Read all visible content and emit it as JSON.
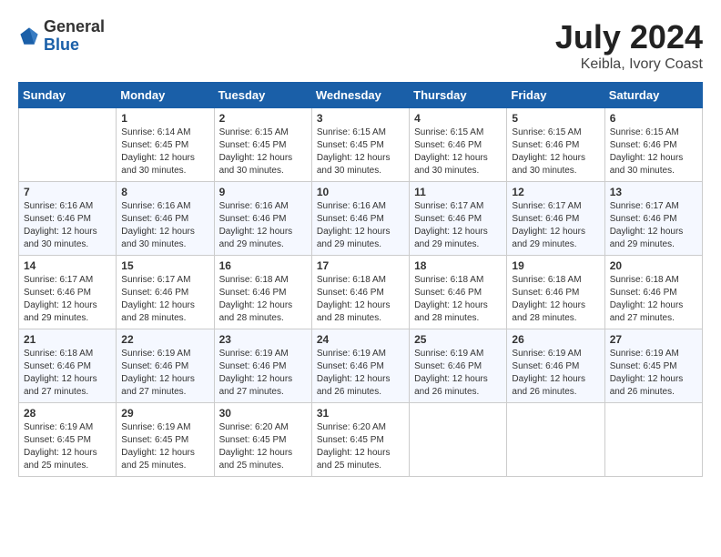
{
  "header": {
    "logo_general": "General",
    "logo_blue": "Blue",
    "title": "July 2024",
    "subtitle": "Keibla, Ivory Coast"
  },
  "columns": [
    "Sunday",
    "Monday",
    "Tuesday",
    "Wednesday",
    "Thursday",
    "Friday",
    "Saturday"
  ],
  "weeks": [
    [
      {
        "day": "",
        "info": ""
      },
      {
        "day": "1",
        "info": "Sunrise: 6:14 AM\nSunset: 6:45 PM\nDaylight: 12 hours\nand 30 minutes."
      },
      {
        "day": "2",
        "info": "Sunrise: 6:15 AM\nSunset: 6:45 PM\nDaylight: 12 hours\nand 30 minutes."
      },
      {
        "day": "3",
        "info": "Sunrise: 6:15 AM\nSunset: 6:45 PM\nDaylight: 12 hours\nand 30 minutes."
      },
      {
        "day": "4",
        "info": "Sunrise: 6:15 AM\nSunset: 6:46 PM\nDaylight: 12 hours\nand 30 minutes."
      },
      {
        "day": "5",
        "info": "Sunrise: 6:15 AM\nSunset: 6:46 PM\nDaylight: 12 hours\nand 30 minutes."
      },
      {
        "day": "6",
        "info": "Sunrise: 6:15 AM\nSunset: 6:46 PM\nDaylight: 12 hours\nand 30 minutes."
      }
    ],
    [
      {
        "day": "7",
        "info": "Sunrise: 6:16 AM\nSunset: 6:46 PM\nDaylight: 12 hours\nand 30 minutes."
      },
      {
        "day": "8",
        "info": "Sunrise: 6:16 AM\nSunset: 6:46 PM\nDaylight: 12 hours\nand 30 minutes."
      },
      {
        "day": "9",
        "info": "Sunrise: 6:16 AM\nSunset: 6:46 PM\nDaylight: 12 hours\nand 29 minutes."
      },
      {
        "day": "10",
        "info": "Sunrise: 6:16 AM\nSunset: 6:46 PM\nDaylight: 12 hours\nand 29 minutes."
      },
      {
        "day": "11",
        "info": "Sunrise: 6:17 AM\nSunset: 6:46 PM\nDaylight: 12 hours\nand 29 minutes."
      },
      {
        "day": "12",
        "info": "Sunrise: 6:17 AM\nSunset: 6:46 PM\nDaylight: 12 hours\nand 29 minutes."
      },
      {
        "day": "13",
        "info": "Sunrise: 6:17 AM\nSunset: 6:46 PM\nDaylight: 12 hours\nand 29 minutes."
      }
    ],
    [
      {
        "day": "14",
        "info": "Sunrise: 6:17 AM\nSunset: 6:46 PM\nDaylight: 12 hours\nand 29 minutes."
      },
      {
        "day": "15",
        "info": "Sunrise: 6:17 AM\nSunset: 6:46 PM\nDaylight: 12 hours\nand 28 minutes."
      },
      {
        "day": "16",
        "info": "Sunrise: 6:18 AM\nSunset: 6:46 PM\nDaylight: 12 hours\nand 28 minutes."
      },
      {
        "day": "17",
        "info": "Sunrise: 6:18 AM\nSunset: 6:46 PM\nDaylight: 12 hours\nand 28 minutes."
      },
      {
        "day": "18",
        "info": "Sunrise: 6:18 AM\nSunset: 6:46 PM\nDaylight: 12 hours\nand 28 minutes."
      },
      {
        "day": "19",
        "info": "Sunrise: 6:18 AM\nSunset: 6:46 PM\nDaylight: 12 hours\nand 28 minutes."
      },
      {
        "day": "20",
        "info": "Sunrise: 6:18 AM\nSunset: 6:46 PM\nDaylight: 12 hours\nand 27 minutes."
      }
    ],
    [
      {
        "day": "21",
        "info": "Sunrise: 6:18 AM\nSunset: 6:46 PM\nDaylight: 12 hours\nand 27 minutes."
      },
      {
        "day": "22",
        "info": "Sunrise: 6:19 AM\nSunset: 6:46 PM\nDaylight: 12 hours\nand 27 minutes."
      },
      {
        "day": "23",
        "info": "Sunrise: 6:19 AM\nSunset: 6:46 PM\nDaylight: 12 hours\nand 27 minutes."
      },
      {
        "day": "24",
        "info": "Sunrise: 6:19 AM\nSunset: 6:46 PM\nDaylight: 12 hours\nand 26 minutes."
      },
      {
        "day": "25",
        "info": "Sunrise: 6:19 AM\nSunset: 6:46 PM\nDaylight: 12 hours\nand 26 minutes."
      },
      {
        "day": "26",
        "info": "Sunrise: 6:19 AM\nSunset: 6:46 PM\nDaylight: 12 hours\nand 26 minutes."
      },
      {
        "day": "27",
        "info": "Sunrise: 6:19 AM\nSunset: 6:45 PM\nDaylight: 12 hours\nand 26 minutes."
      }
    ],
    [
      {
        "day": "28",
        "info": "Sunrise: 6:19 AM\nSunset: 6:45 PM\nDaylight: 12 hours\nand 25 minutes."
      },
      {
        "day": "29",
        "info": "Sunrise: 6:19 AM\nSunset: 6:45 PM\nDaylight: 12 hours\nand 25 minutes."
      },
      {
        "day": "30",
        "info": "Sunrise: 6:20 AM\nSunset: 6:45 PM\nDaylight: 12 hours\nand 25 minutes."
      },
      {
        "day": "31",
        "info": "Sunrise: 6:20 AM\nSunset: 6:45 PM\nDaylight: 12 hours\nand 25 minutes."
      },
      {
        "day": "",
        "info": ""
      },
      {
        "day": "",
        "info": ""
      },
      {
        "day": "",
        "info": ""
      }
    ]
  ]
}
